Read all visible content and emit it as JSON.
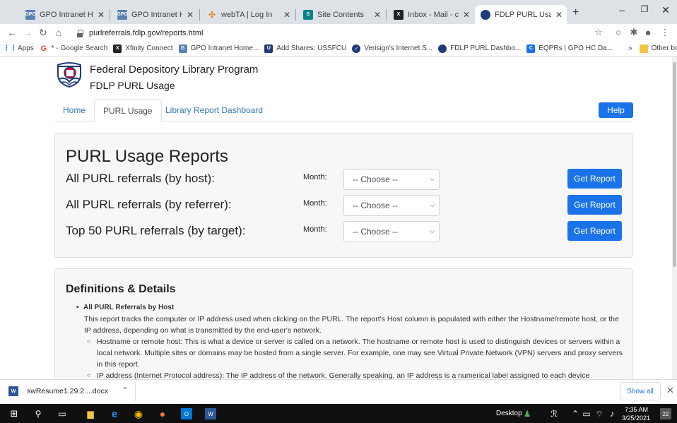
{
  "browser": {
    "tabs": [
      {
        "title": "GPO Intranet Home",
        "icon": "gpo-icon",
        "active": false
      },
      {
        "title": "GPO Intranet Home",
        "icon": "gpo-icon",
        "active": false
      },
      {
        "title": "webTA | Log In",
        "icon": "webta-icon",
        "active": false
      },
      {
        "title": "Site Contents",
        "icon": "sharepoint-icon",
        "active": false
      },
      {
        "title": "Inbox - Mail - coachj",
        "icon": "xfinity-icon",
        "active": false
      },
      {
        "title": "FDLP PURL Usage",
        "icon": "fdlp-icon",
        "active": true
      }
    ],
    "url": "purlreferrals.fdlp.gov/reports.html",
    "bookmarks": [
      {
        "label": "Apps",
        "icon": "apps-grid-icon"
      },
      {
        "label": "* - Google Search",
        "icon": "google-icon"
      },
      {
        "label": "Xfinity Connect",
        "icon": "xfinity-icon"
      },
      {
        "label": "GPO Intranet Home...",
        "icon": "gpo-icon"
      },
      {
        "label": "Add Shares: USSFCU",
        "icon": "ussfcu-icon"
      },
      {
        "label": "Verisign's Internet S...",
        "icon": "verisign-icon"
      },
      {
        "label": "FDLP PURL Dashbo...",
        "icon": "fdlp-icon"
      },
      {
        "label": "EQPRs | GPO HC Da...",
        "icon": "eqprs-icon"
      }
    ],
    "bookmarks_more": "»",
    "other_bookmarks": "Other bookmarks"
  },
  "site": {
    "org_title": "Federal Depository Library Program",
    "org_subtitle": "FDLP PURL Usage",
    "nav": [
      {
        "label": "Home",
        "active": false
      },
      {
        "label": "PURL Usage",
        "active": true
      },
      {
        "label": "Library Report Dashboard",
        "active": false
      }
    ],
    "help_label": "Help"
  },
  "reports": {
    "heading": "PURL Usage Reports",
    "month_label": "Month:",
    "select_placeholder": "-- Choose --",
    "button_label": "Get Report",
    "rows": [
      {
        "label": "All PURL referrals (by host):"
      },
      {
        "label": "All PURL referrals (by referrer):"
      },
      {
        "label": "Top 50 PURL referrals (by target):"
      }
    ]
  },
  "definitions": {
    "heading": "Definitions & Details",
    "item_title": "All PURL Referrals by Host",
    "para": "This report tracks the computer or IP address used when clicking on the PURL. The report's Host column is populated with either the Hostname/remote host, or the IP address, depending on what is transmitted by the end-user's network.",
    "sub1": "Hostname or remote host: This is what a device or server is called on a network. The hostname or remote host is used to distinguish devices or servers within a local network. Multiple sites or domains may be hosted from a single server. For example, one may see Virtual Private Network (VPN) servers and proxy servers in this report.",
    "sub2": "IP address (Internet Protocol address): The IP address of the network. Generally speaking, an IP address is a numerical label assigned to each device"
  },
  "downloads": {
    "file": "swResume1.29.2....docx",
    "show_all": "Show all"
  },
  "taskbar": {
    "desktop_label": "Desktop",
    "time": "7:35 AM",
    "date": "3/25/2021",
    "notif_count": "22"
  }
}
